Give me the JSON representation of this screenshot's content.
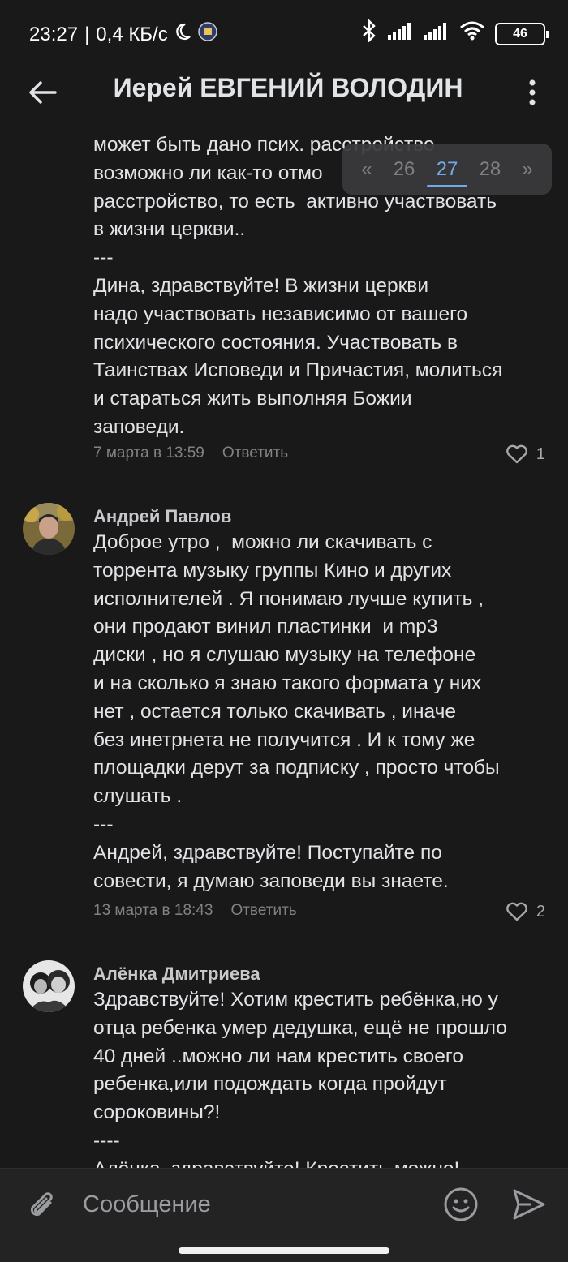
{
  "status_bar": {
    "time": "23:27",
    "separator": "|",
    "speed": "0,4 КБ/с",
    "battery": "46",
    "icons": [
      "moon-icon",
      "app-notification-icon",
      "bluetooth-icon",
      "signal-icon",
      "signal-icon",
      "wifi-icon",
      "battery-icon"
    ]
  },
  "header": {
    "title": "Иерей ЕВГЕНИЙ ВОЛОДИН",
    "back_icon": "arrow-left-icon",
    "menu_icon": "more-vertical-icon"
  },
  "pager": {
    "prev": "«",
    "pages": [
      "26",
      "27",
      "28"
    ],
    "current": "27",
    "next": "»"
  },
  "comments": [
    {
      "author": "",
      "text": "может быть дано псих. расстройство\nвозможно ли как-то отмо\nрасстройство, то есть  активно участвовать\nв жизни церкви..\n---\nДина, здравствуйте! В жизни церкви\nнадо участвовать независимо от вашего\nпсихического состояния. Участвовать в\nТаинствах Исповеди и Причастия, молиться\nи стараться жить выполняя Божии\nзаповеди.",
      "date": "7 марта в 13:59",
      "reply": "Ответить",
      "likes": "1"
    },
    {
      "author": "Андрей Павлов",
      "text": "Доброе утро ,  можно ли скачивать с\nторрента музыку группы Кино и других\nисполнителей . Я понимаю лучше купить ,\nони продают винил пластинки  и mp3\nдиски , но я слушаю музыку на телефоне\nи на сколько я знаю такого формата у них\nнет , остается только скачивать , иначе\nбез инетрнета не получится . И к тому же\nплощадки дерут за подписку , просто чтобы\nслушать .\n---\nАндрей, здравствуйте! Поступайте по\nсовести, я думаю заповеди вы знаете.",
      "date": "13 марта в 18:43",
      "reply": "Ответить",
      "likes": "2"
    },
    {
      "author": "Алёнка Дмитриева",
      "text": "Здравствуйте! Хотим крестить ребёнка,но у\nотца ребенка умер дедушка, ещё не прошло\n40 дней ..можно ли нам крестить своего\nребенка,или подождать когда пройдут\nсороковины?!\n----\nАлёнка, здравствуйте! Крестить можно!",
      "date": "",
      "reply": "",
      "likes": ""
    }
  ],
  "composer": {
    "placeholder": "Сообщение",
    "attach_icon": "paperclip-icon",
    "emoji_icon": "smile-icon",
    "send_icon": "send-icon"
  }
}
